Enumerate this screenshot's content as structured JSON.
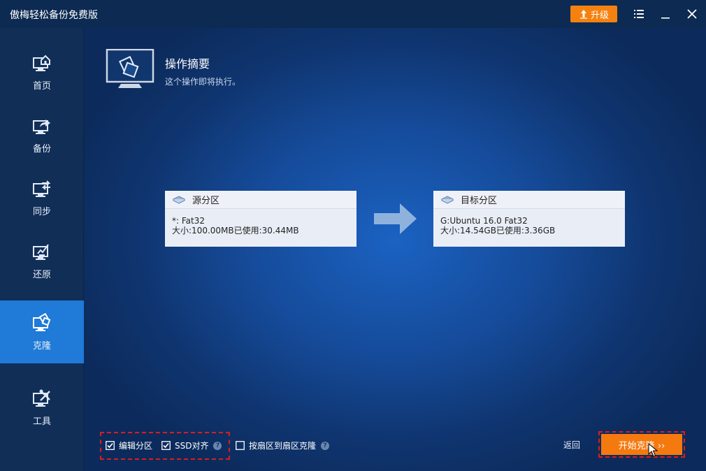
{
  "app": {
    "title": "傲梅轻松备份免费版",
    "upgrade_label": "升级"
  },
  "colors": {
    "accent": "#f47a10",
    "active_nav": "#1f7ad8",
    "highlight_border": "#e01b1b"
  },
  "sidebar": {
    "items": [
      {
        "label": "首页",
        "icon": "home-icon",
        "active": false
      },
      {
        "label": "备份",
        "icon": "backup-icon",
        "active": false
      },
      {
        "label": "同步",
        "icon": "sync-icon",
        "active": false
      },
      {
        "label": "还原",
        "icon": "restore-icon",
        "active": false
      },
      {
        "label": "克隆",
        "icon": "clone-icon",
        "active": true
      },
      {
        "label": "工具",
        "icon": "tools-icon",
        "active": false
      }
    ]
  },
  "header": {
    "title": "操作摘要",
    "subtitle": "这个操作即将执行。"
  },
  "source": {
    "title": "源分区",
    "line1": "*: Fat32",
    "line2": "大小:100.00MB已使用:30.44MB"
  },
  "target": {
    "title": "目标分区",
    "line1": "G:Ubuntu 16.0 Fat32",
    "line2": "大小:14.54GB已使用:3.36GB"
  },
  "options": {
    "edit_partition": {
      "label": "编辑分区",
      "checked": true
    },
    "ssd_align": {
      "label": "SSD对齐",
      "checked": true
    },
    "sector_by_sector": {
      "label": "按扇区到扇区克隆",
      "checked": false
    }
  },
  "footer": {
    "back_label": "返回",
    "start_label": "开始克隆 ››"
  }
}
